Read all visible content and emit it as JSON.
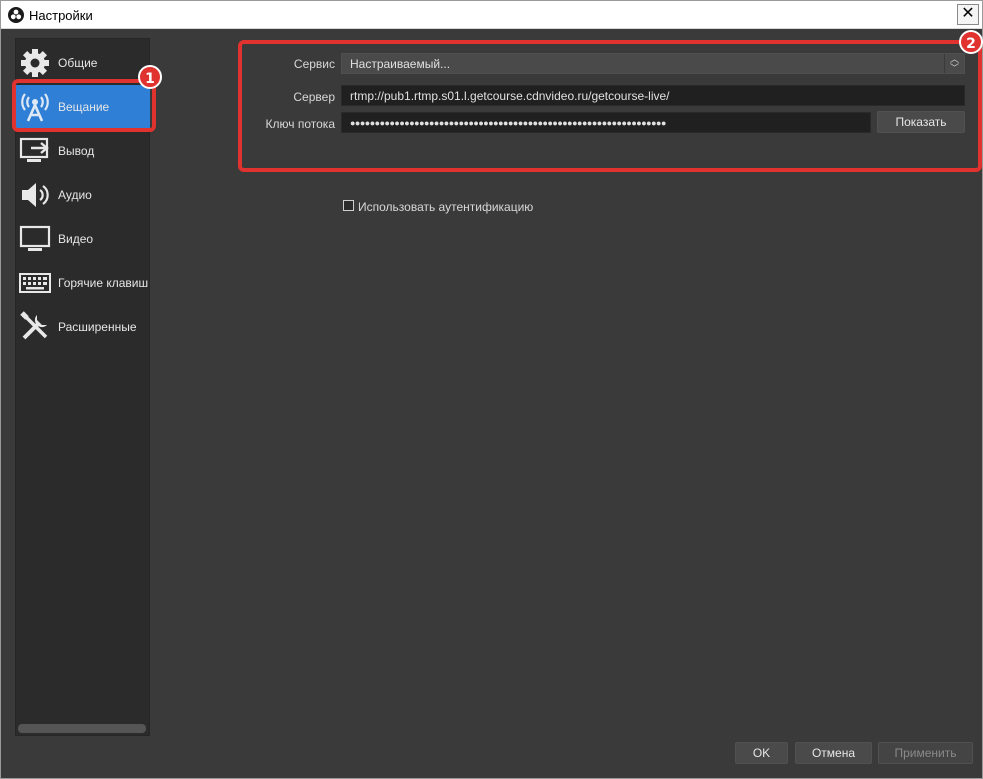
{
  "window": {
    "title": "Настройки",
    "close_glyph": "✕"
  },
  "sidebar": {
    "items": [
      {
        "label": "Общие",
        "icon": "gear-icon"
      },
      {
        "label": "Вещание",
        "icon": "broadcast-icon",
        "active": true
      },
      {
        "label": "Вывод",
        "icon": "output-icon"
      },
      {
        "label": "Аудио",
        "icon": "speaker-icon"
      },
      {
        "label": "Видео",
        "icon": "monitor-icon"
      },
      {
        "label": "Горячие клавиш",
        "icon": "keyboard-icon"
      },
      {
        "label": "Расширенные",
        "icon": "tools-icon"
      }
    ]
  },
  "stream": {
    "service_label": "Сервис",
    "service_value": "Настраиваемый...",
    "server_label": "Сервер",
    "server_value": "rtmp://pub1.rtmp.s01.l.getcourse.cdnvideo.ru/getcourse-live/",
    "key_label": "Ключ потока",
    "key_value": "●●●●●●●●●●●●●●●●●●●●●●●●●●●●●●●●●●●●●●●●●●●●●●●●●●●●●●●●●●●●●●●●",
    "show_button": "Показать",
    "auth_checkbox_label": "Использовать аутентификацию",
    "auth_checked": false
  },
  "annotations": {
    "badge_1": "1",
    "badge_2": "2",
    "highlight_color": "#e0322e"
  },
  "footer": {
    "ok": "OK",
    "cancel": "Отмена",
    "apply": "Применить"
  },
  "colors": {
    "accent": "#2f7fd6",
    "background": "#3a3a3a",
    "panel": "#2b2b2b"
  }
}
